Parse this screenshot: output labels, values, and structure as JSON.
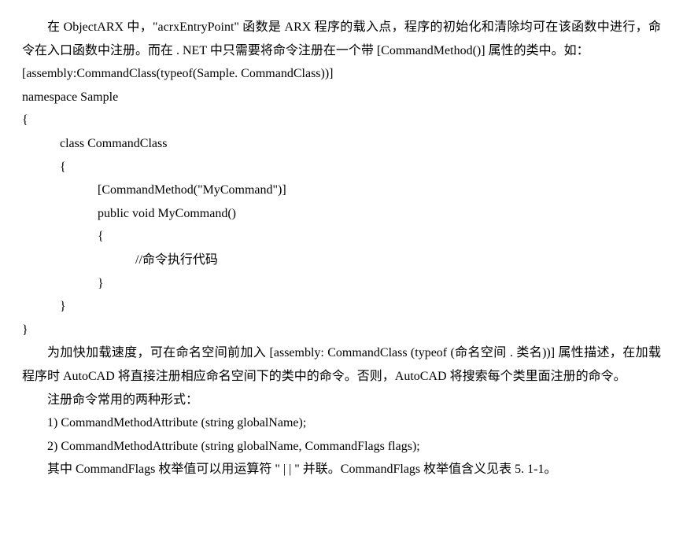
{
  "para1": "在 ObjectARX 中，\"acrxEntryPoint\" 函数是 ARX 程序的载入点，程序的初始化和清除均可在该函数中进行，命令在入口函数中注册。而在 . NET 中只需要将命令注册在一个带 [CommandMethod()] 属性的类中。如：",
  "code": {
    "l1": "[assembly:CommandClass(typeof(Sample. CommandClass))]",
    "l2": "namespace Sample",
    "l3": "{",
    "l4": "class CommandClass",
    "l5": "{",
    "l6": "[CommandMethod(\"MyCommand\")]",
    "l7": "public void MyCommand()",
    "l8": "{",
    "l9": "//命令执行代码",
    "l10": "}",
    "l11": "}",
    "l12": "}"
  },
  "para2": "为加快加载速度，可在命名空间前加入 [assembly: CommandClass (typeof (命名空间 . 类名))] 属性描述，在加载程序时 AutoCAD 将直接注册相应命名空间下的类中的命令。否则，AutoCAD 将搜索每个类里面注册的命令。",
  "para3": "注册命令常用的两种形式：",
  "item1": "1) CommandMethodAttribute (string globalName);",
  "item2": "2) CommandMethodAttribute (string globalName, CommandFlags flags);",
  "para4": "其中 CommandFlags 枚举值可以用运算符 \" | | \" 并联。CommandFlags 枚举值含义见表 5. 1-1。"
}
